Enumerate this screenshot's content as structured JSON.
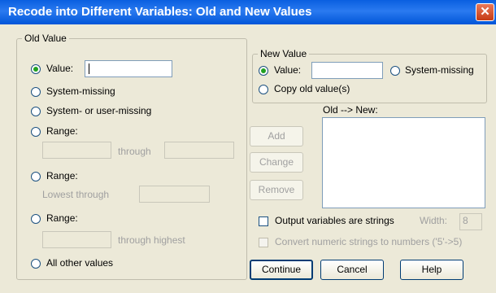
{
  "window": {
    "title": "Recode into Different Variables: Old and New Values",
    "close_glyph": "✕"
  },
  "old_value": {
    "legend": "Old Value",
    "value_label": "Value:",
    "value_input": "",
    "system_missing": "System-missing",
    "system_or_user_missing": "System- or user-missing",
    "range1_label": "Range:",
    "range1_through": "through",
    "range2_label": "Range:",
    "range2_lowest_through": "Lowest through",
    "range3_label": "Range:",
    "range3_through_highest": "through highest",
    "all_other_values": "All other values",
    "selected": "Value:"
  },
  "new_value": {
    "legend": "New Value",
    "value_label": "Value:",
    "value_input": "",
    "system_missing": "System-missing",
    "copy_old_value": "Copy old value(s)",
    "selected": "Value:"
  },
  "mapping": {
    "label": "Old --> New:",
    "add": "Add",
    "change": "Change",
    "remove": "Remove"
  },
  "options": {
    "output_strings": "Output variables are strings",
    "output_strings_checked": false,
    "width_label": "Width:",
    "width_value": "8",
    "convert_numeric": "Convert numeric strings to numbers ('5'->5)",
    "convert_numeric_checked": false
  },
  "buttons": {
    "continue": "Continue",
    "cancel": "Cancel",
    "help": "Help"
  }
}
